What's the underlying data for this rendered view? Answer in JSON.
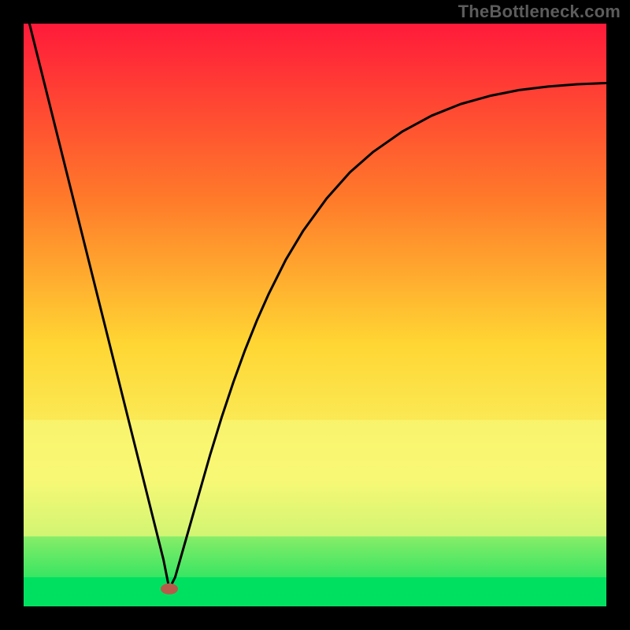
{
  "watermark": "TheBottleneck.com",
  "chart_data": {
    "type": "line",
    "title": "",
    "xlabel": "",
    "ylabel": "",
    "xlim": [
      0,
      100
    ],
    "ylim": [
      0,
      100
    ],
    "background_gradient": {
      "top": "#ff1a3a",
      "mid_upper": "#ff7a2a",
      "mid": "#ffd633",
      "mid_lower": "#f7f76e",
      "bottom": "#00e060"
    },
    "yellow_band": {
      "from": 68,
      "to": 88
    },
    "green_strip": {
      "from": 95,
      "to": 100
    },
    "marker": {
      "x": 25,
      "y": 97,
      "color": "#b85a4a"
    },
    "series": [
      {
        "name": "curve",
        "x": [
          0,
          2,
          4,
          6,
          8,
          10,
          12,
          14,
          16,
          18,
          20,
          22,
          24,
          25,
          26,
          28,
          30,
          32,
          34,
          36,
          38,
          40,
          42,
          45,
          48,
          52,
          56,
          60,
          65,
          70,
          75,
          80,
          85,
          90,
          95,
          100
        ],
        "y": [
          -4,
          4,
          12,
          20,
          28,
          36,
          44,
          52,
          60,
          68,
          76,
          84,
          92,
          97,
          95,
          88,
          81,
          74,
          67.5,
          61.5,
          56,
          51,
          46.5,
          40.5,
          35.5,
          30,
          25.5,
          22,
          18.5,
          15.8,
          13.8,
          12.4,
          11.4,
          10.8,
          10.4,
          10.2
        ]
      }
    ]
  }
}
